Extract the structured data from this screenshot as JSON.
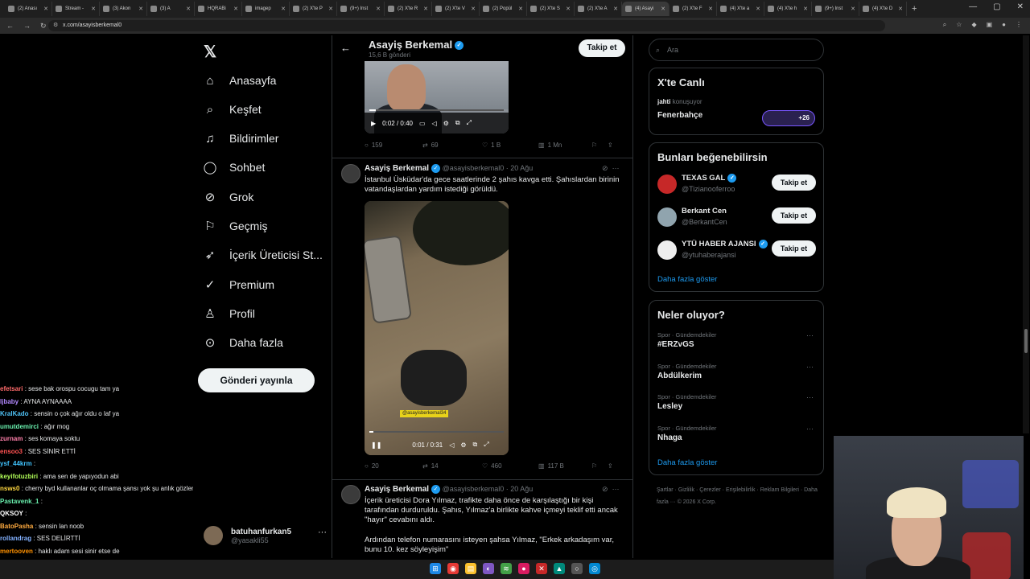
{
  "browser": {
    "tabs": [
      {
        "label": "(2) Anası",
        "active": false
      },
      {
        "label": "Stream -",
        "active": false
      },
      {
        "label": "(3) Akon",
        "active": false
      },
      {
        "label": "(3) A",
        "active": false
      },
      {
        "label": "HQRABi",
        "active": false
      },
      {
        "label": "imagep",
        "active": false
      },
      {
        "label": "(2) X'te P",
        "active": false
      },
      {
        "label": "(9+) Inst",
        "active": false
      },
      {
        "label": "(2) X'te R",
        "active": false
      },
      {
        "label": "(2) X'te V",
        "active": false
      },
      {
        "label": "(2) Popül",
        "active": false
      },
      {
        "label": "(2) X'te S",
        "active": false
      },
      {
        "label": "(2) X'te A",
        "active": false
      },
      {
        "label": "(4) Asayi",
        "active": true
      },
      {
        "label": "(2) X'te F",
        "active": false
      },
      {
        "label": "(4) X'te a",
        "active": false
      },
      {
        "label": "(4) X'te h",
        "active": false
      },
      {
        "label": "(9+) Inst",
        "active": false
      },
      {
        "label": "(4) X'te D",
        "active": false
      }
    ],
    "url": "x.com/asayisberkemal0"
  },
  "nav": {
    "items": [
      {
        "label": "Anasayfa",
        "icon": "home-icon"
      },
      {
        "label": "Keşfet",
        "icon": "search-icon"
      },
      {
        "label": "Bildirimler",
        "icon": "bell-icon"
      },
      {
        "label": "Sohbet",
        "icon": "chat-icon"
      },
      {
        "label": "Grok",
        "icon": "grok-icon"
      },
      {
        "label": "Geçmiş",
        "icon": "bookmark-icon"
      },
      {
        "label": "İçerik Üreticisi St...",
        "icon": "rocket-icon"
      },
      {
        "label": "Premium",
        "icon": "premium-icon"
      },
      {
        "label": "Profil",
        "icon": "profile-icon"
      },
      {
        "label": "Daha fazla",
        "icon": "more-circle-icon"
      }
    ],
    "post_button": "Gönderi yayınla",
    "account": {
      "name": "batuhanfurkan5",
      "handle": "@yasakli55"
    }
  },
  "chat": [
    {
      "user": "efetsari",
      "color": "#ff6b6b",
      "msg": "sese bak orospu cocugu tam ya"
    },
    {
      "user": "ljbaby",
      "color": "#b388ff",
      "msg": "AYNA AYNAAAA"
    },
    {
      "user": "KralKado",
      "color": "#4fc3f7",
      "msg": "sensin o çok ağır oldu o laf ya"
    },
    {
      "user": "umutdemirci",
      "color": "#69f0ae",
      "msg": "ağır mog"
    },
    {
      "user": "zurnam",
      "color": "#ff80ab",
      "msg": "ses komaya soktu"
    },
    {
      "user": "ensoo3",
      "color": "#ff5252",
      "msg": "SES SİNİR ETTİ"
    },
    {
      "user": "ysf_44krm",
      "color": "#40c4ff",
      "msg": ""
    },
    {
      "user": "keyifotuzbiri",
      "color": "#b2ff59",
      "msg": "ama sen de yapıyodun abi"
    },
    {
      "user": "nsws0",
      "color": "#ffd740",
      "msg": "cherry byd kullananlar oç olmama şansı yok şu anlık gözlemim bu"
    },
    {
      "user": "Pastavenk_1",
      "color": "#69f0ae",
      "msg": ""
    },
    {
      "user": "QKSOY",
      "color": "#ffffff",
      "msg": ""
    },
    {
      "user": "BatoPasha",
      "color": "#ffab40",
      "msg": "sensin lan noob"
    },
    {
      "user": "rollandrag",
      "color": "#82b1ff",
      "msg": "SES DELİRTTİ"
    },
    {
      "user": "mertooven",
      "color": "#ff9100",
      "msg": "haklı adam sesi sinir etse de"
    }
  ],
  "profile": {
    "name": "Asayiş Berkemal",
    "posts_count": "15,6 B gönderi",
    "follow_label": "Takip et"
  },
  "tweets": [
    {
      "video_time": "0:02 / 0:40",
      "progress": 0.05,
      "replies": "159",
      "retweets": "69",
      "likes": "1 B",
      "views": "1 Mn"
    },
    {
      "author": "Asayiş Berkemal",
      "handle": "@asayisberkemal0",
      "date": "20 Ağu",
      "text": "İstanbul Üsküdar'da gece saatlerinde 2 şahıs kavga etti. Şahıslardan birinin vatandaşlardan yardım istediği görüldü.",
      "video_time": "0:01 / 0:31",
      "video_tag": "@asayisberkemal34",
      "progress": 0.03,
      "replies": "20",
      "retweets": "14",
      "likes": "460",
      "views": "117 B"
    },
    {
      "author": "Asayiş Berkemal",
      "handle": "@asayisberkemal0",
      "date": "20 Ağu",
      "text": "İçerik üreticisi Dora Yılmaz, trafikte daha önce de karşılaştığı bir kişi tarafından durduruldu. Şahıs, Yılmaz'a birlikte kahve içmeyi teklif etti ancak \"hayır\" cevabını aldı.",
      "text2": "Ardından telefon numarasını isteyen şahsa Yılmaz, \"Erkek arkadaşım var, bunu 10. kez söyleyişim\""
    }
  ],
  "sidebar": {
    "search_placeholder": "Ara",
    "live": {
      "title": "X'te Canlı",
      "host": "jahti",
      "host_suffix": "konuşuyor",
      "topic": "Fenerbahçe",
      "extra": "+26"
    },
    "suggestions": {
      "title": "Bunları beğenebilirsin",
      "items": [
        {
          "name": "TEXAS GAL",
          "handle": "@Tizianooferroo",
          "button": "Takip et",
          "color": "#c62828"
        },
        {
          "name": "Berkant Cen",
          "handle": "@BerkantCen",
          "button": "Takip et",
          "color": "#90a4ae"
        },
        {
          "name": "YTÜ HABER AJANSI",
          "handle": "@ytuhaberajansi",
          "button": "Takip et",
          "color": "#eeeeee"
        }
      ],
      "more": "Daha fazla göster"
    },
    "trends": {
      "title": "Neler oluyor?",
      "items": [
        {
          "category": "Spor · Gündemdekiler",
          "name": "#ERZvGS"
        },
        {
          "category": "Spor · Gündemdekiler",
          "name": "Abdülkerim"
        },
        {
          "category": "Spor · Gündemdekiler",
          "name": "Lesley"
        },
        {
          "category": "Spor · Gündemdekiler",
          "name": "Nhaga"
        }
      ],
      "more": "Daha fazla göster"
    },
    "footer": "Şartlar · Gizlilik · Çerezler · Erişilebilirlik · Reklam Bilgileri · Daha fazla ··· © 2026 X Corp."
  }
}
